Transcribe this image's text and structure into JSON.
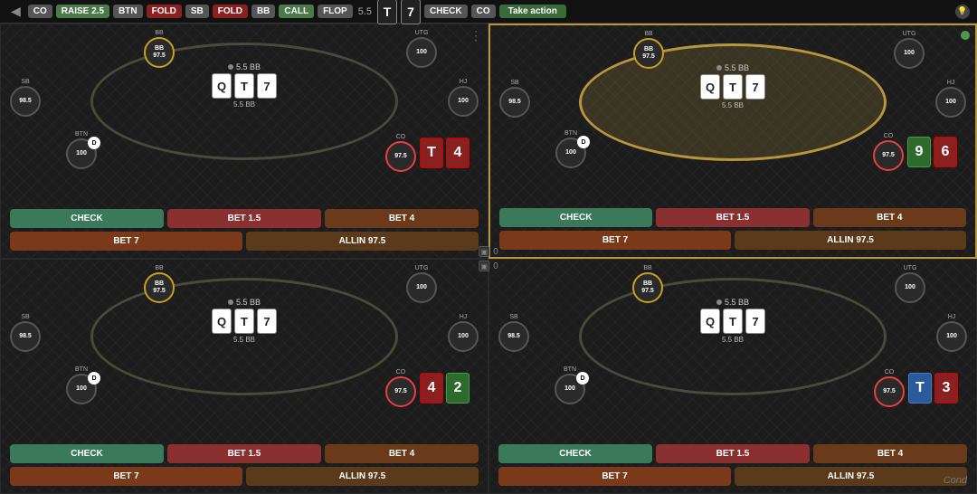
{
  "toolbar": {
    "back_label": "◀",
    "position_co": "CO",
    "action_raise": "RAISE 2.5",
    "action_btn": "BTN",
    "action_fold": "FOLD",
    "action_sb": "SB",
    "action_fold2": "FOLD",
    "action_bb": "BB",
    "action_call": "CALL",
    "action_flop": "FLOP",
    "flop_value": "5.5",
    "card1": "T",
    "card2": "7",
    "action_check": "CHECK",
    "action_co": "CO",
    "take_action": "Take action",
    "bulb": "💡"
  },
  "quadrants": [
    {
      "id": "q1",
      "active": false,
      "pot": "5.5 BB",
      "community_cards": [
        {
          "label": "Q",
          "suit": "white"
        },
        {
          "label": "T",
          "suit": "white"
        },
        {
          "label": "7",
          "suit": "white"
        }
      ],
      "hero_cards": [
        {
          "label": "T",
          "color": "red"
        },
        {
          "label": "4",
          "color": "red"
        }
      ],
      "players": {
        "bb": {
          "pos": "BB",
          "stack": "97.5"
        },
        "utg": {
          "pos": "UTG",
          "stack": "100"
        },
        "hj": {
          "pos": "HJ",
          "stack": "100"
        },
        "co": {
          "pos": "CO",
          "stack": "97.5"
        },
        "btn": {
          "pos": "BTN",
          "stack": "100"
        },
        "sb": {
          "pos": "SB",
          "stack": "98.5"
        }
      },
      "actions": {
        "check": "CHECK",
        "bet15": "BET 1.5",
        "bet4": "BET 4",
        "bet7": "BET 7",
        "allin": "ALLIN 97.5"
      },
      "stack_label": "5.5 BB"
    },
    {
      "id": "q2",
      "active": true,
      "pot": "5.5 BB",
      "community_cards": [
        {
          "label": "Q",
          "suit": "white"
        },
        {
          "label": "T",
          "suit": "white"
        },
        {
          "label": "7",
          "suit": "white"
        }
      ],
      "hero_cards": [
        {
          "label": "9",
          "color": "green"
        },
        {
          "label": "6",
          "color": "red"
        }
      ],
      "players": {
        "bb": {
          "pos": "BB",
          "stack": "97.5"
        },
        "utg": {
          "pos": "UTG",
          "stack": "100"
        },
        "hj": {
          "pos": "HJ",
          "stack": "100"
        },
        "co": {
          "pos": "CO",
          "stack": "97.5"
        },
        "btn": {
          "pos": "BTN",
          "stack": "100"
        },
        "sb": {
          "pos": "SB",
          "stack": "98.5"
        }
      },
      "actions": {
        "check": "CHECK",
        "bet15": "BET 1.5",
        "bet4": "BET 4",
        "bet7": "BET 7",
        "allin": "ALLIN 97.5"
      },
      "stack_label": "5.5 BB"
    },
    {
      "id": "q3",
      "active": false,
      "pot": "5.5 BB",
      "community_cards": [
        {
          "label": "Q",
          "suit": "white"
        },
        {
          "label": "T",
          "suit": "white"
        },
        {
          "label": "7",
          "suit": "white"
        }
      ],
      "hero_cards": [
        {
          "label": "4",
          "color": "red"
        },
        {
          "label": "2",
          "color": "green"
        }
      ],
      "players": {
        "bb": {
          "pos": "BB",
          "stack": "97.5"
        },
        "utg": {
          "pos": "UTG",
          "stack": "100"
        },
        "hj": {
          "pos": "HJ",
          "stack": "100"
        },
        "co": {
          "pos": "CO",
          "stack": "97.5"
        },
        "btn": {
          "pos": "BTN",
          "stack": "100"
        },
        "sb": {
          "pos": "SB",
          "stack": "98.5"
        }
      },
      "actions": {
        "check": "CHECK",
        "bet15": "BET 1.5",
        "bet4": "BET 4",
        "bet7": "BET 7",
        "allin": "ALLIN 97.5"
      },
      "stack_label": "5.5 BB"
    },
    {
      "id": "q4",
      "active": false,
      "pot": "5.5 BB",
      "community_cards": [
        {
          "label": "Q",
          "suit": "white"
        },
        {
          "label": "T",
          "suit": "white"
        },
        {
          "label": "7",
          "suit": "white"
        }
      ],
      "hero_cards": [
        {
          "label": "T",
          "color": "blue"
        },
        {
          "label": "3",
          "color": "red"
        }
      ],
      "players": {
        "bb": {
          "pos": "BB",
          "stack": "97.5"
        },
        "utg": {
          "pos": "UTG",
          "stack": "100"
        },
        "hj": {
          "pos": "HJ",
          "stack": "100"
        },
        "co": {
          "pos": "CO",
          "stack": "97.5"
        },
        "btn": {
          "pos": "BTN",
          "stack": "100"
        },
        "sb": {
          "pos": "SB",
          "stack": "98.5"
        }
      },
      "actions": {
        "check": "CHECK",
        "bet15": "BET 1.5",
        "bet4": "BET 4",
        "bet7": "BET 7",
        "allin": "ALLIN 97.5"
      },
      "stack_label": "5.5 BB"
    }
  ],
  "center": {
    "dot_color": "#4a9a4a",
    "count1": "0",
    "count2": "0"
  },
  "bottom_label": "Cond"
}
